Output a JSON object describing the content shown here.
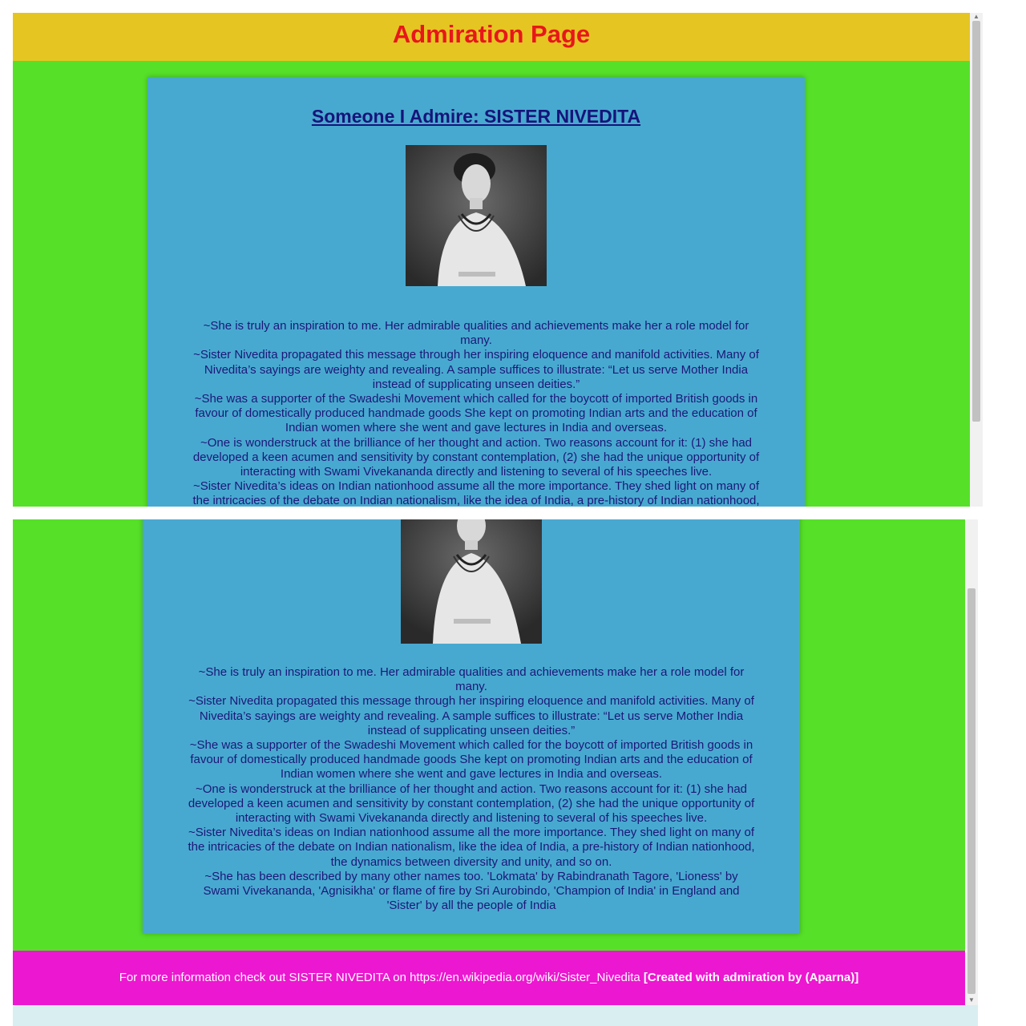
{
  "header": {
    "title": "Admiration Page"
  },
  "card": {
    "heading": "Someone I Admire: SISTER NIVEDITA",
    "paragraphs": [
      "~She is truly an inspiration to me. Her admirable qualities and achievements make her a role model for many.",
      "~Sister Nivedita propagated this message through her inspiring eloquence and manifold activities. Many of Nivedita’s sayings are weighty and revealing. A sample suffices to illustrate: “Let us serve Mother India instead of supplicating unseen deities.”",
      "~She was a supporter of the Swadeshi Movement which called for the boycott of imported British goods in favour of domestically produced handmade goods She kept on promoting Indian arts and the education of Indian women where she went and gave lectures in India and overseas.",
      "~One is wonderstruck at the brilliance of her thought and action. Two reasons account for it: (1) she had developed a keen acumen and sensitivity by constant contemplation, (2) she had the unique opportunity of interacting with Swami Vivekananda directly and listening to several of his speeches live.",
      "~Sister Nivedita’s ideas on Indian nationhood assume all the more importance. They shed light on many of the intricacies of the debate on Indian nationalism, like the idea of India, a pre-history of Indian nationhood, the dynamics between diversity and unity, and so on.",
      "~She has been described by many other names too. 'Lokmata' by Rabindranath Tagore, 'Lioness' by Swami Vivekananda, 'Agnisikha' or flame of fire by Sri Aurobindo, 'Champion of India' in England and 'Sister' by all the people of India"
    ]
  },
  "footer": {
    "text": "For more information check out SISTER NIVEDITA on https://en.wikipedia.org/wiki/Sister_Nivedita",
    "credit": "[Created with admiration by (Aparna)]"
  },
  "colors": {
    "header_bg": "#e5c522",
    "title_color": "#e8161b",
    "page_bg": "#56e028",
    "card_bg": "#48a9d0",
    "text_color": "#1c1878",
    "footer_bg": "#ec17d0"
  }
}
